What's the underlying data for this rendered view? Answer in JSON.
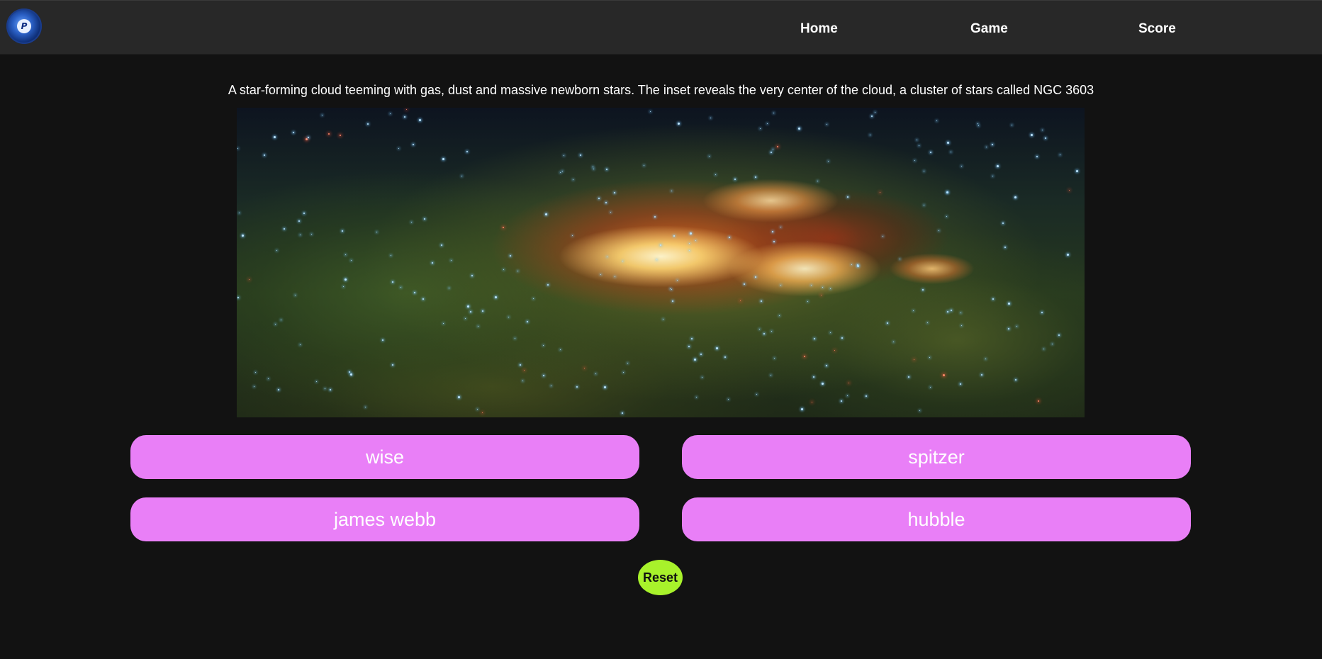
{
  "nav": {
    "logo_letter": "P",
    "links": [
      {
        "label": "Home"
      },
      {
        "label": "Game"
      },
      {
        "label": "Score"
      }
    ]
  },
  "question": {
    "caption": "A star-forming cloud teeming with gas, dust and massive newborn stars. The inset reveals the very center of the cloud, a cluster of stars called NGC 3603",
    "image_icon": "nebula-image"
  },
  "answers": [
    {
      "label": "wise"
    },
    {
      "label": "spitzer"
    },
    {
      "label": "james webb"
    },
    {
      "label": "hubble"
    }
  ],
  "reset_label": "Reset",
  "colors": {
    "background": "#121212",
    "navbar": "#282828",
    "answer_button": "#e97ff7",
    "reset_button": "#a8f22b"
  }
}
